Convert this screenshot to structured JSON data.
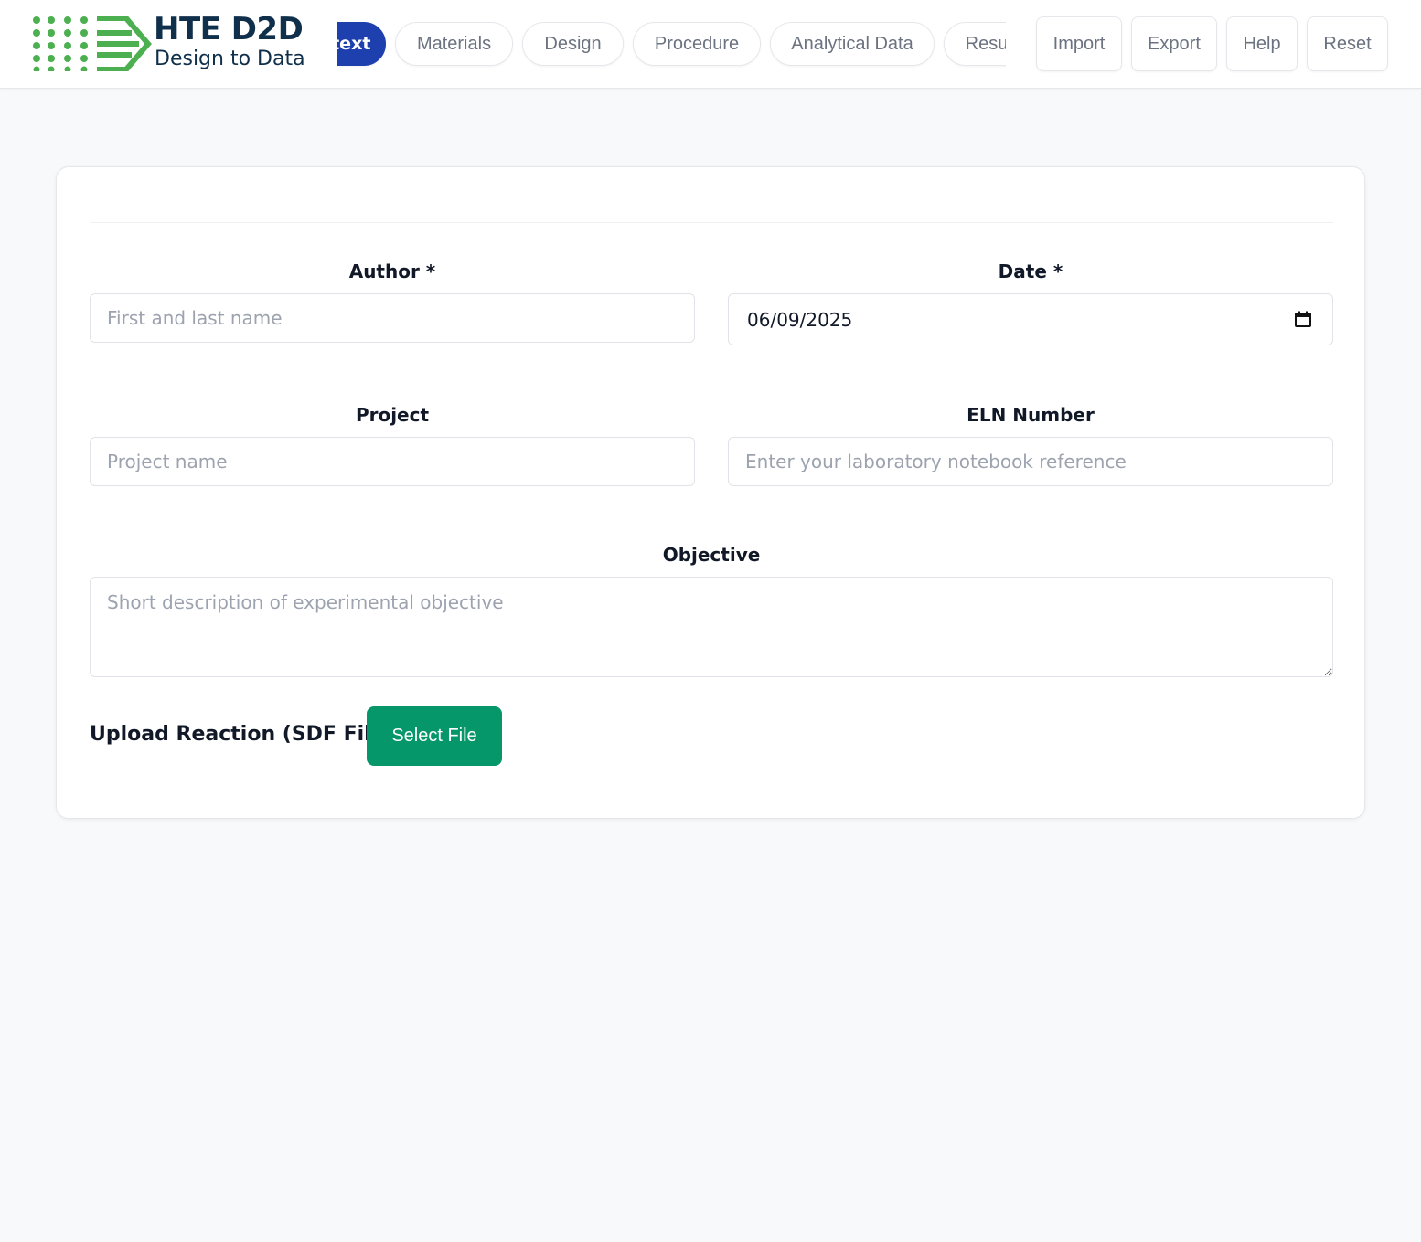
{
  "app": {
    "logo_title": "HTE D2D",
    "logo_subtitle": "Design to Data"
  },
  "nav": {
    "tabs": [
      {
        "label": "Context",
        "active": true
      },
      {
        "label": "Materials",
        "active": false
      },
      {
        "label": "Design",
        "active": false
      },
      {
        "label": "Procedure",
        "active": false
      },
      {
        "label": "Analytical Data",
        "active": false
      },
      {
        "label": "Results",
        "active": false
      }
    ]
  },
  "actions": {
    "import_label": "Import",
    "export_label": "Export",
    "help_label": "Help",
    "reset_label": "Reset"
  },
  "form": {
    "author_label": "Author *",
    "author_placeholder": "First and last name",
    "author_value": "",
    "date_label": "Date *",
    "date_value": "06/09/2025",
    "project_label": "Project",
    "project_placeholder": "Project name",
    "project_value": "",
    "eln_label": "ELN Number",
    "eln_placeholder": "Enter your laboratory notebook reference",
    "eln_value": "",
    "objective_label": "Objective",
    "objective_placeholder": "Short description of experimental objective",
    "objective_value": "",
    "upload_label": "Upload Reaction (SDF File)",
    "select_file_label": "Select File"
  },
  "colors": {
    "brand_navy": "#0f2f4a",
    "brand_green": "#4caf50",
    "active_tab": "#1e40af",
    "primary_action": "#059669"
  },
  "icons": {
    "logo": "hte-d2d-logo-icon",
    "date_picker": "calendar-icon"
  }
}
